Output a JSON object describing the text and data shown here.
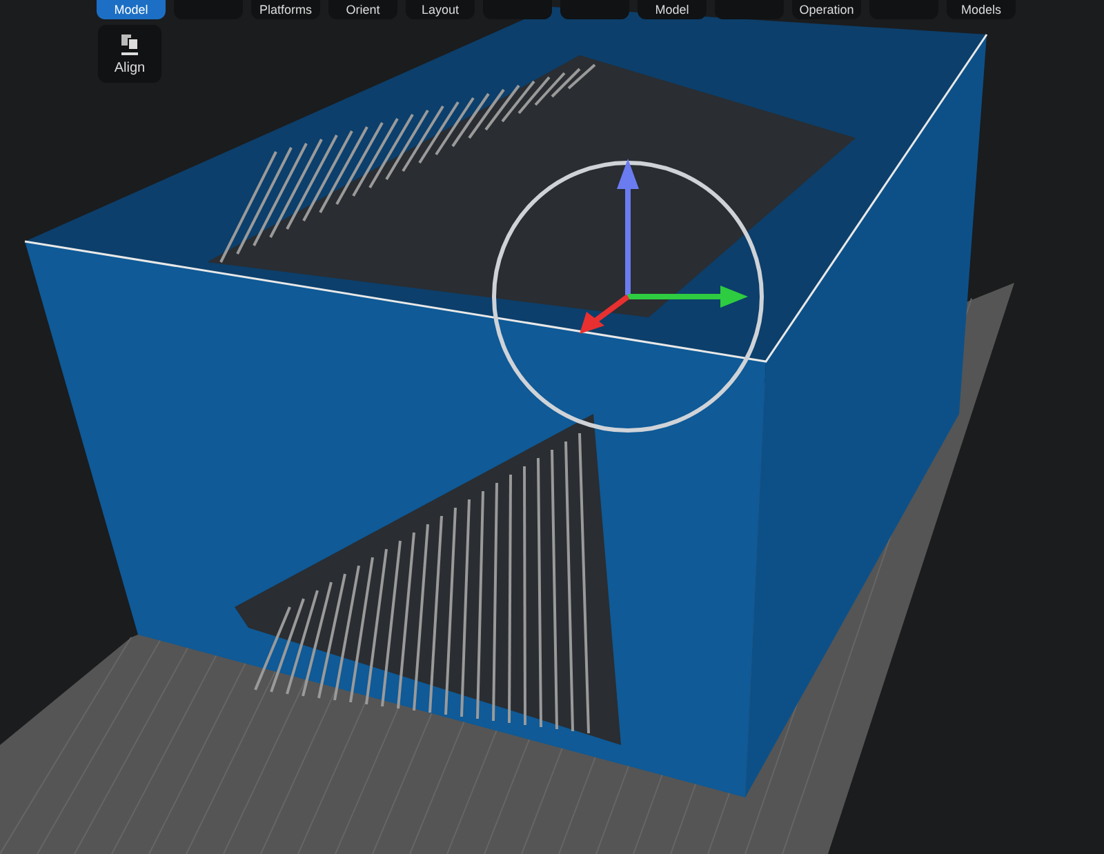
{
  "toolbar": {
    "buttons": [
      {
        "label": "Model",
        "selected": true
      },
      {
        "selected": false
      },
      {
        "label": "Platforms",
        "selected": false
      },
      {
        "label": "Orient",
        "selected": false
      },
      {
        "label": "Layout",
        "selected": false
      },
      {
        "selected": false
      },
      {
        "selected": false
      },
      {
        "label": "Model",
        "selected": false
      },
      {
        "selected": false
      },
      {
        "label": "Operation",
        "selected": false
      },
      {
        "selected": false
      },
      {
        "label": "Models",
        "selected": false
      }
    ]
  },
  "side_panel": {
    "tools": [
      {
        "label": "Align"
      }
    ]
  }
}
